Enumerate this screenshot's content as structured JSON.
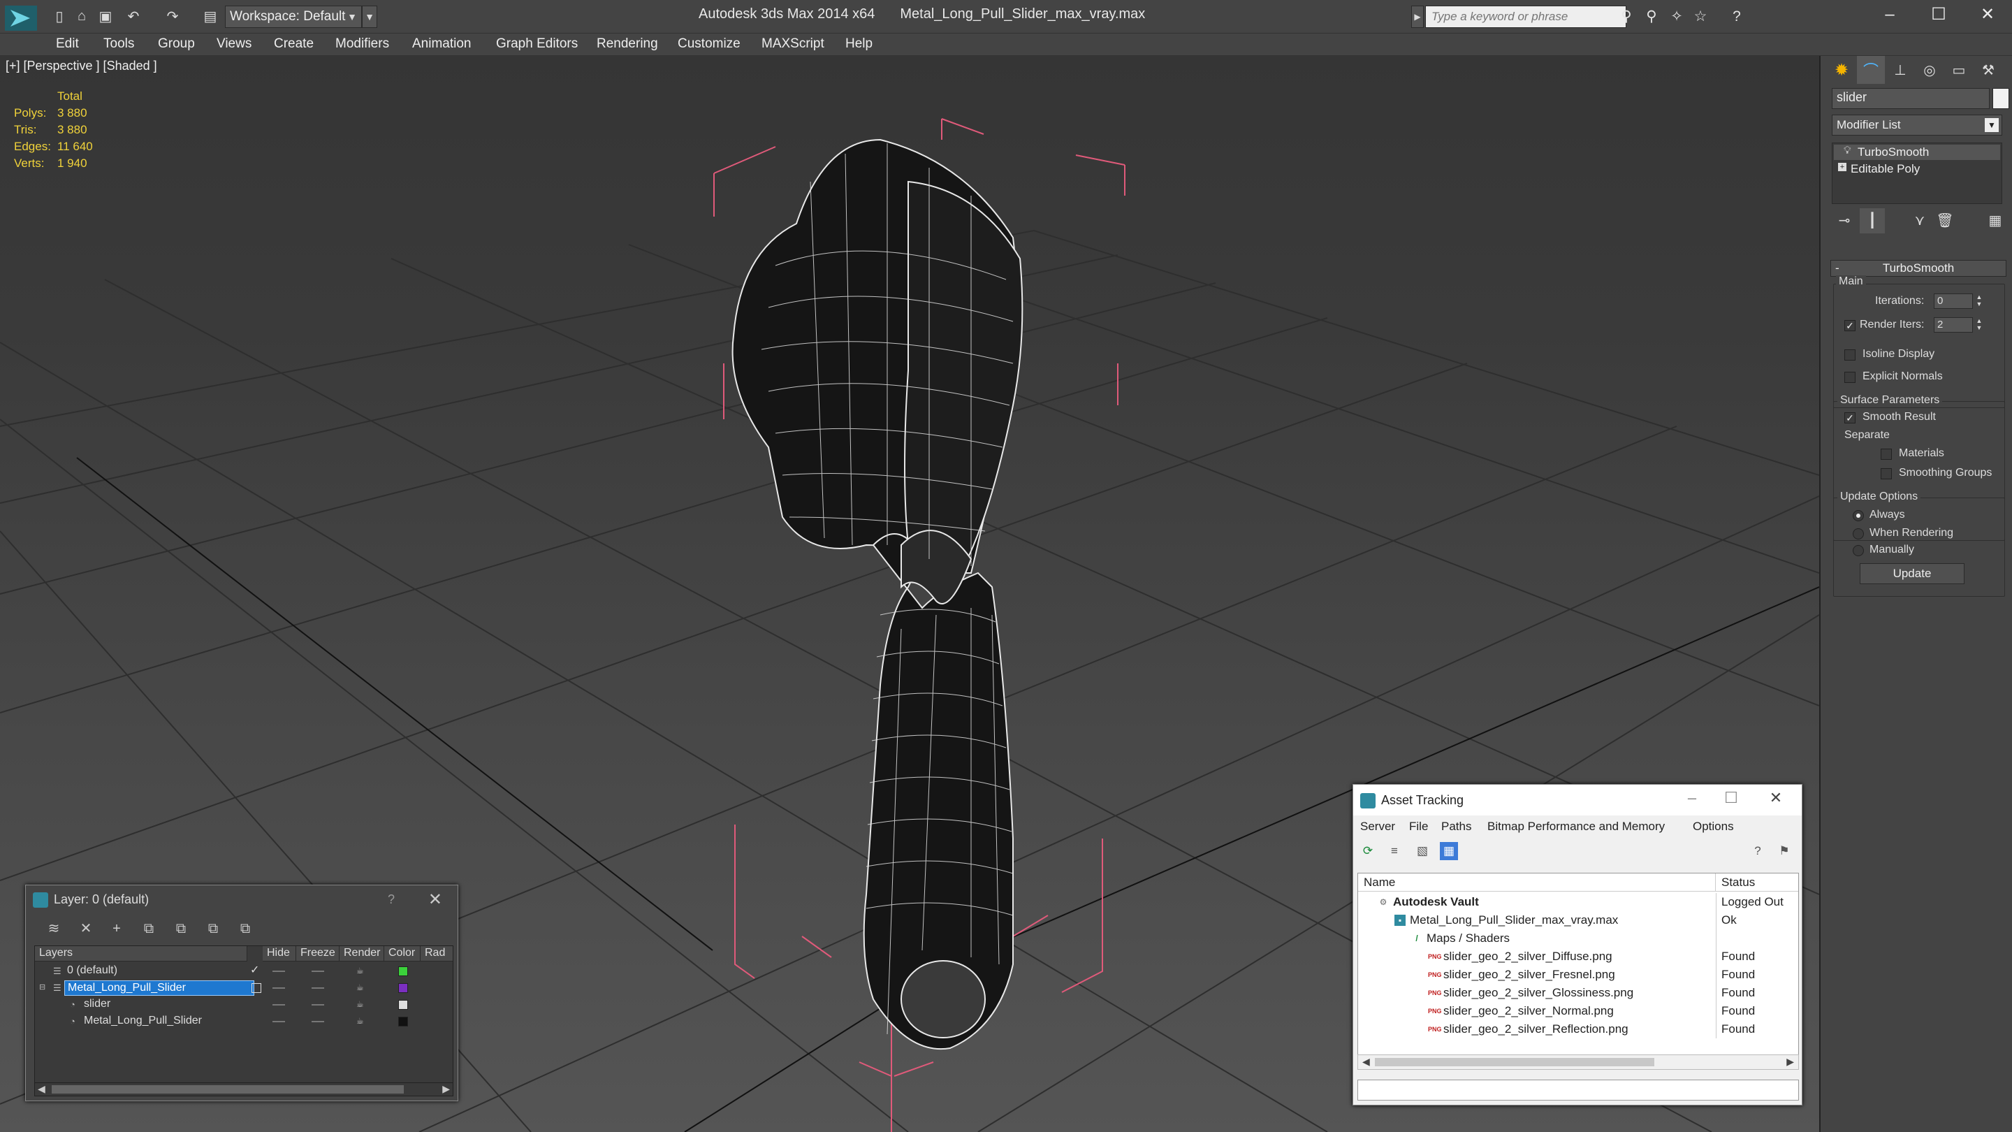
{
  "titlebar": {
    "workspace_label": "Workspace: Default",
    "app_name": "Autodesk 3ds Max  2014 x64",
    "file_name": "Metal_Long_Pull_Slider_max_vray.max",
    "search_placeholder": "Type a keyword or phrase"
  },
  "menu": [
    "Edit",
    "Tools",
    "Group",
    "Views",
    "Create",
    "Modifiers",
    "Animation",
    "Graph Editors",
    "Rendering",
    "Customize",
    "MAXScript",
    "Help"
  ],
  "viewport": {
    "label": "[+] [Perspective ] [Shaded ]",
    "stats_header": "Total",
    "stats": [
      {
        "label": "Polys:",
        "value": "3 880"
      },
      {
        "label": "Tris:",
        "value": "3 880"
      },
      {
        "label": "Edges:",
        "value": "11 640"
      },
      {
        "label": "Verts:",
        "value": "1 940"
      }
    ]
  },
  "command_panel": {
    "object_name": "slider",
    "modifier_list": "Modifier List",
    "stack": [
      "TurboSmooth",
      "Editable Poly"
    ],
    "rollout_title": "TurboSmooth",
    "main_group": "Main",
    "iterations_label": "Iterations:",
    "iterations_value": "0",
    "render_iters_label": "Render Iters:",
    "render_iters_value": "2",
    "render_iters_checked": true,
    "isoline_label": "Isoline Display",
    "explicit_normals_label": "Explicit Normals",
    "surface_group": "Surface Parameters",
    "smooth_result_label": "Smooth Result",
    "separate_label": "Separate",
    "materials_label": "Materials",
    "smoothing_groups_label": "Smoothing Groups",
    "update_group": "Update Options",
    "always_label": "Always",
    "when_rendering_label": "When Rendering",
    "manually_label": "Manually",
    "update_button": "Update"
  },
  "layer_window": {
    "title": "Layer: 0 (default)",
    "help": "?",
    "columns": [
      "Layers",
      "Hide",
      "Freeze",
      "Render",
      "Color",
      "Rad"
    ],
    "rows": [
      {
        "name": "0 (default)",
        "color": "#3bd13b",
        "indent": 1
      },
      {
        "name": "Metal_Long_Pull_Slider",
        "color": "#7b2fc0",
        "indent": 1,
        "selected": true
      },
      {
        "name": "slider",
        "color": "#dddddd",
        "indent": 2
      },
      {
        "name": "Metal_Long_Pull_Slider",
        "color": "#111111",
        "indent": 2
      }
    ]
  },
  "asset_window": {
    "title": "Asset Tracking",
    "menu": [
      "Server",
      "File",
      "Paths",
      "Bitmap Performance and Memory",
      "Options"
    ],
    "columns": [
      "Name",
      "Status"
    ],
    "rows": [
      {
        "name": "Autodesk Vault",
        "status": "Logged Out",
        "indent": 1,
        "icon": "vault-icon"
      },
      {
        "name": "Metal_Long_Pull_Slider_max_vray.max",
        "status": "Ok",
        "indent": 2,
        "icon": "max-file-icon"
      },
      {
        "name": "Maps / Shaders",
        "status": "",
        "indent": 3,
        "icon": "maps-icon"
      },
      {
        "name": "slider_geo_2_silver_Diffuse.png",
        "status": "Found",
        "indent": 4,
        "icon": "png-icon"
      },
      {
        "name": "slider_geo_2_silver_Fresnel.png",
        "status": "Found",
        "indent": 4,
        "icon": "png-icon"
      },
      {
        "name": "slider_geo_2_silver_Glossiness.png",
        "status": "Found",
        "indent": 4,
        "icon": "png-icon"
      },
      {
        "name": "slider_geo_2_silver_Normal.png",
        "status": "Found",
        "indent": 4,
        "icon": "png-icon"
      },
      {
        "name": "slider_geo_2_silver_Reflection.png",
        "status": "Found",
        "indent": 4,
        "icon": "png-icon"
      }
    ]
  }
}
